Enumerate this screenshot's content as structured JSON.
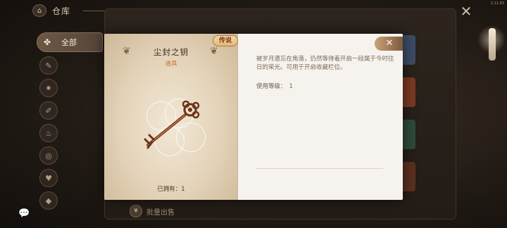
{
  "version": "2.11.63",
  "header": {
    "title": "仓库",
    "home_icon": "home-icon",
    "close_icon": "close-x-icon"
  },
  "sidebar": {
    "active_tab": {
      "label": "全部",
      "icon": "clover-icon"
    },
    "tabs": [
      {
        "icon": "tool-icon"
      },
      {
        "icon": "gear-icon"
      },
      {
        "icon": "brush-icon"
      },
      {
        "icon": "pot-icon"
      },
      {
        "icon": "spiral-icon"
      },
      {
        "icon": "badge-icon"
      },
      {
        "icon": "stamp-icon"
      }
    ]
  },
  "footer": {
    "chat_icon": "chat-bubble-icon",
    "batch_sell_label": "批量出售",
    "batch_sell_icon": "coin-icon"
  },
  "item_dialog": {
    "name": "尘封之钥",
    "type": "道具",
    "rarity": "传说",
    "image_icon": "antique-key-icon",
    "owned_label": "已拥有：",
    "owned_count": "1",
    "description": "被岁月遗忘在角落，仍然等待着开启一段属于今时往日的荣光。可用于开启收藏栏位。",
    "level_label": "使用等级：",
    "level_value": "1",
    "close_icon": "close-x-icon"
  },
  "colors": {
    "rarity_badge": "#e1b87a",
    "type_text": "#c8783a",
    "level_value": "#4a8a3a",
    "dialog_bg": "#f4f1ec"
  }
}
